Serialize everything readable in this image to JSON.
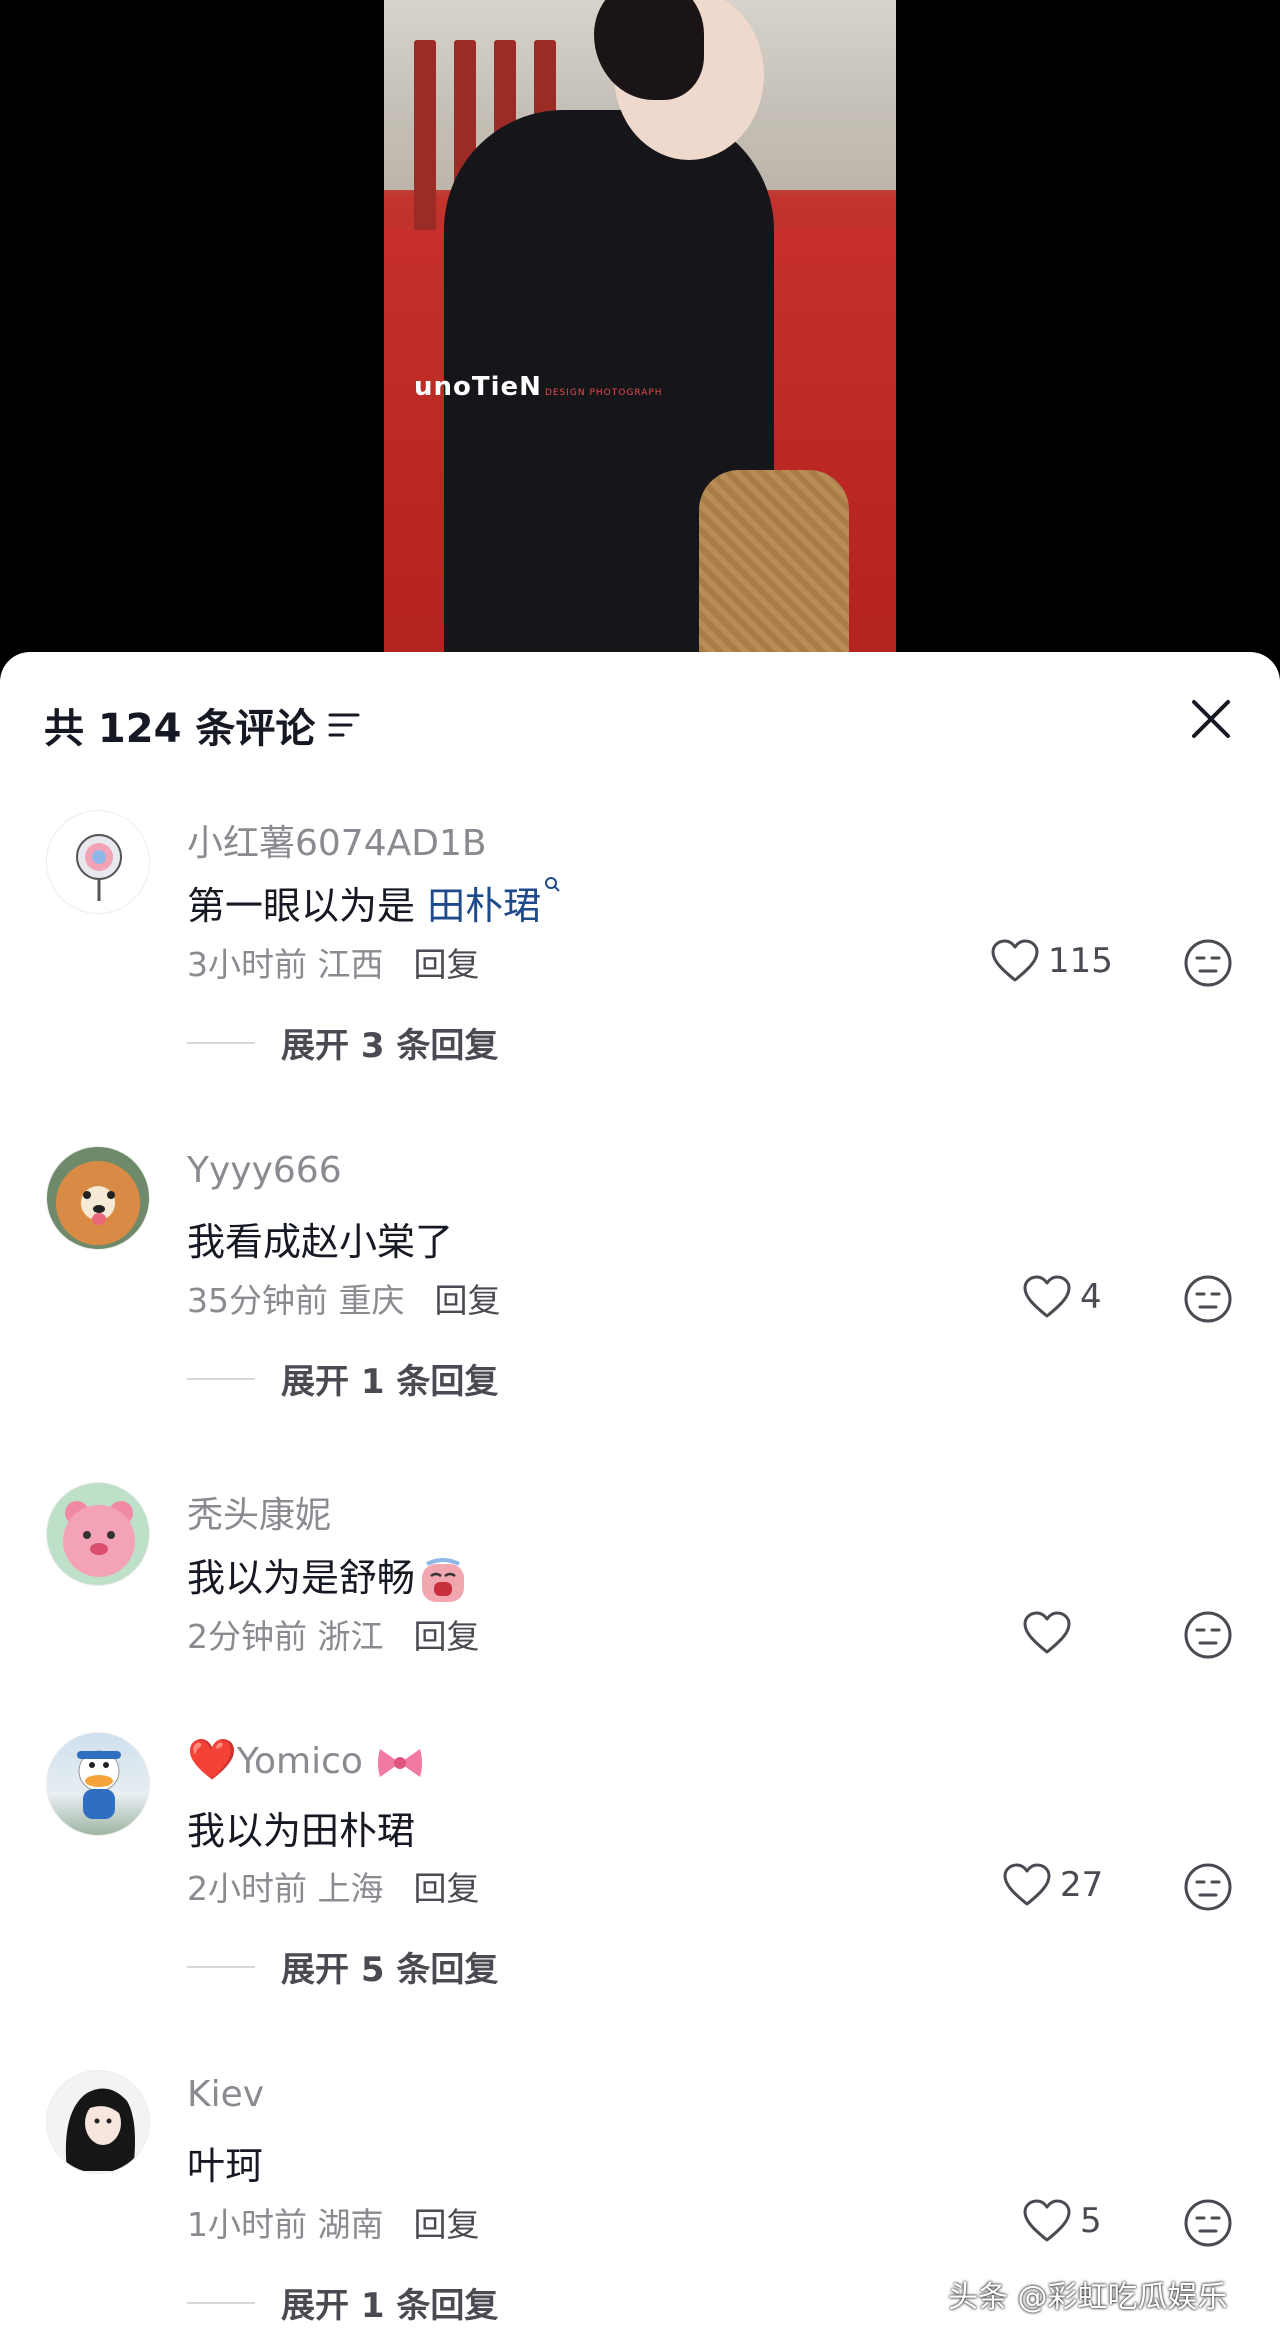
{
  "video": {
    "watermark": "unoTieN",
    "watermark_sub": "DESIGN PHOTOGRAPH"
  },
  "header": {
    "comment_count": "共 124 条评论",
    "sort_icon": "sort-lines-icon",
    "close_icon": "close-icon"
  },
  "comments": [
    {
      "username": "小红薯6074AD1B",
      "text": "第一眼以为是 ",
      "highlight": "田朴珺",
      "search_icon": "search-icon",
      "time": "3小时前",
      "location": "江西",
      "reply_label": "回复",
      "likes": "115",
      "expand_label": "展开 3 条回复",
      "avatar": "lollipop-avatar"
    },
    {
      "username": "Yyyy666",
      "text": "我看成赵小棠了",
      "time": "35分钟前",
      "location": "重庆",
      "reply_label": "回复",
      "likes": "4",
      "expand_label": "展开 1 条回复",
      "avatar": "shiba-dog-avatar"
    },
    {
      "username": "秃头康妮",
      "text": "我以为是舒畅",
      "emoji": "crying-face-emoji",
      "time": "2分钟前",
      "location": "浙江",
      "reply_label": "回复",
      "likes": "",
      "avatar": "pink-bear-avatar"
    },
    {
      "username_prefix": "❤️",
      "username": "Yomico",
      "username_suffix": "🎀",
      "text": "我以为田朴珺",
      "time": "2小时前",
      "location": "上海",
      "reply_label": "回复",
      "likes": "27",
      "expand_label": "展开 5 条回复",
      "avatar": "donald-duck-avatar"
    },
    {
      "username": "Kiev",
      "text": "叶珂",
      "time": "1小时前",
      "location": "湖南",
      "reply_label": "回复",
      "likes": "5",
      "expand_label": "展开 1 条回复",
      "avatar": "anime-girl-avatar"
    }
  ],
  "source_tag": "头条 @彩虹吃瓜娱乐",
  "colors": {
    "username": "#8a8b91",
    "text": "#161823",
    "highlight": "#1e4a8a",
    "background": "#ffffff"
  }
}
